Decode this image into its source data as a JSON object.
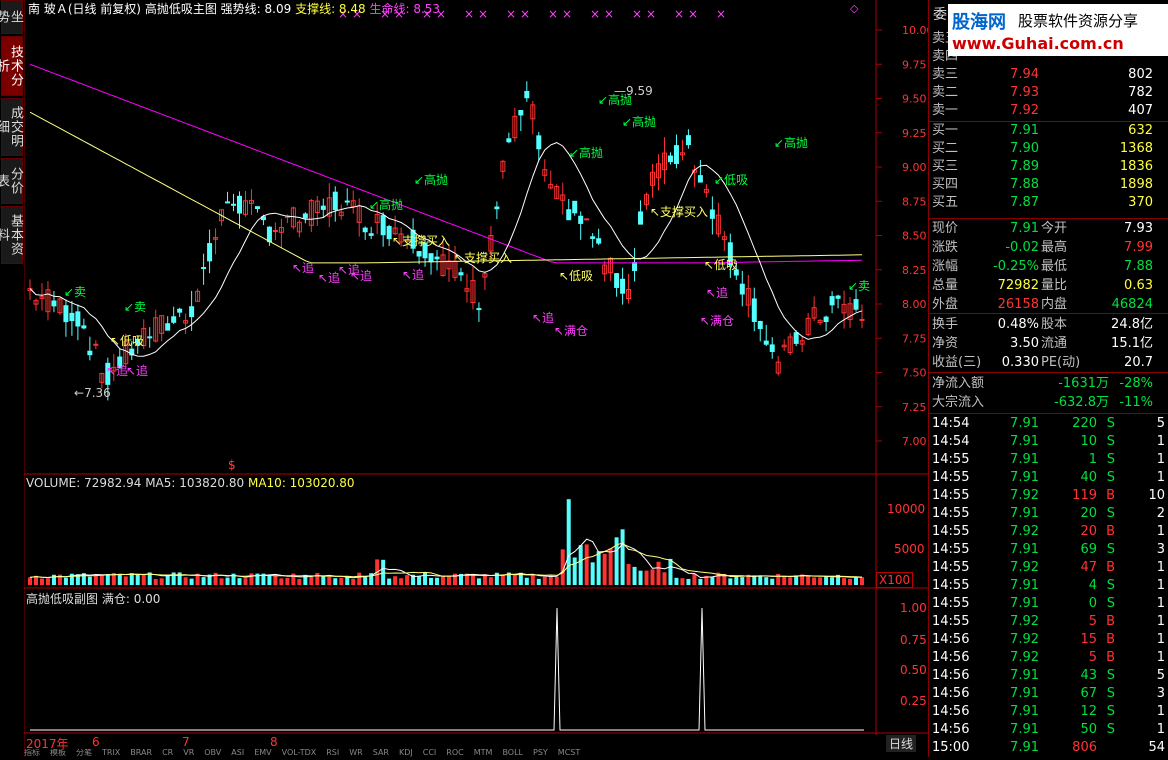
{
  "title_bar": {
    "stock": "南 玻Ａ(日线 前复权)",
    "indicator": "高抛低吸主图",
    "strong_label": "强势线: 8.09",
    "support_label": "支撑线: 8.48",
    "life_label": "生命线: 8.53"
  },
  "side_tabs": [
    "技术分析",
    "成交明细",
    "分价表",
    "基本资料"
  ],
  "side_top": "坐势",
  "price_axis": [
    "10.00",
    "9.75",
    "9.50",
    "9.25",
    "9.00",
    "8.75",
    "8.50",
    "8.25",
    "8.00",
    "7.75",
    "7.50",
    "7.25",
    "7.00"
  ],
  "annotations": {
    "high": "9.59",
    "low": "7.36",
    "sell_labels": [
      "卖",
      "卖",
      "卖"
    ],
    "high_throw": [
      "高抛",
      "高抛",
      "高抛",
      "高抛",
      "高抛",
      "高抛"
    ],
    "support_buy": [
      "支撑买入",
      "支撑买入",
      "支撑买入"
    ],
    "low_buy": [
      "低吸",
      "低吸",
      "低吸",
      "低吸"
    ],
    "chase": [
      "追",
      "追",
      "追",
      "追",
      "追",
      "追",
      "追",
      "追"
    ],
    "full": [
      "满仓",
      "满仓"
    ],
    "marker": "$"
  },
  "volume": {
    "label": "VOLUME: 72982.94",
    "ma5": "MA5: 103820.80",
    "ma10": "MA10: 103020.80",
    "axis": [
      "10000",
      "5000"
    ],
    "unit": "X100"
  },
  "sub": {
    "label": "高抛低吸副图",
    "value": "满仓: 0.00",
    "axis": [
      "1.00",
      "0.75",
      "0.50",
      "0.25"
    ]
  },
  "time_axis": [
    "2017年",
    "6",
    "7",
    "8"
  ],
  "period_btn": "日线",
  "bottom_tabs": [
    "指标",
    "模板",
    "分笔",
    "TRIX",
    "BRAR",
    "CR",
    "VR",
    "OBV",
    "ASI",
    "EMV",
    "VOL-TDX",
    "RSI",
    "WR",
    "SAR",
    "KDJ",
    "CCI",
    "ROC",
    "MTM",
    "BOLL",
    "PSY",
    "MCST"
  ],
  "watermark": {
    "site": "股海网",
    "slogan": "股票软件资源分享",
    "url": "www.Guhai.com.cn"
  },
  "quote": {
    "header_label": "委",
    "asks": [
      {
        "label": "卖五",
        "price": "",
        "vol": ""
      },
      {
        "label": "卖四",
        "price": "",
        "vol": ""
      },
      {
        "label": "卖三",
        "price": "7.94",
        "vol": "802"
      },
      {
        "label": "卖二",
        "price": "7.93",
        "vol": "782"
      },
      {
        "label": "卖一",
        "price": "7.92",
        "vol": "407"
      }
    ],
    "bids": [
      {
        "label": "买一",
        "price": "7.91",
        "vol": "632"
      },
      {
        "label": "买二",
        "price": "7.90",
        "vol": "1368"
      },
      {
        "label": "买三",
        "price": "7.89",
        "vol": "1836"
      },
      {
        "label": "买四",
        "price": "7.88",
        "vol": "1898"
      },
      {
        "label": "买五",
        "price": "7.87",
        "vol": "370"
      }
    ],
    "stats": [
      {
        "l1": "现价",
        "v1": "7.91",
        "c1": "green",
        "l2": "今开",
        "v2": "7.93",
        "c2": "white"
      },
      {
        "l1": "涨跌",
        "v1": "-0.02",
        "c1": "green",
        "l2": "最高",
        "v2": "7.99",
        "c2": "red"
      },
      {
        "l1": "涨幅",
        "v1": "-0.25%",
        "c1": "green",
        "l2": "最低",
        "v2": "7.88",
        "c2": "green"
      },
      {
        "l1": "总量",
        "v1": "72982",
        "c1": "yellow",
        "l2": "量比",
        "v2": "0.63",
        "c2": "yellow"
      },
      {
        "l1": "外盘",
        "v1": "26158",
        "c1": "red",
        "l2": "内盘",
        "v2": "46824",
        "c2": "green"
      }
    ],
    "fund": [
      {
        "l1": "换手",
        "v1": "0.48%",
        "l2": "股本",
        "v2": "24.8亿"
      },
      {
        "l1": "净资",
        "v1": "3.50",
        "l2": "流通",
        "v2": "15.1亿"
      },
      {
        "l1": "收益(三)",
        "v1": "0.330",
        "l2": "PE(动)",
        "v2": "20.7"
      }
    ],
    "flow": [
      {
        "l": "净流入额",
        "v": "-1631万",
        "p": "-28%"
      },
      {
        "l": "大宗流入",
        "v": "-632.8万",
        "p": "-11%"
      }
    ],
    "ticks": [
      {
        "t": "14:54",
        "p": "7.91",
        "v": "220",
        "s": "S",
        "n": "5"
      },
      {
        "t": "14:54",
        "p": "7.91",
        "v": "10",
        "s": "S",
        "n": "1"
      },
      {
        "t": "14:55",
        "p": "7.91",
        "v": "1",
        "s": "S",
        "n": "1"
      },
      {
        "t": "14:55",
        "p": "7.91",
        "v": "40",
        "s": "S",
        "n": "1"
      },
      {
        "t": "14:55",
        "p": "7.92",
        "v": "119",
        "s": "B",
        "n": "10"
      },
      {
        "t": "14:55",
        "p": "7.91",
        "v": "20",
        "s": "S",
        "n": "2"
      },
      {
        "t": "14:55",
        "p": "7.92",
        "v": "20",
        "s": "B",
        "n": "1"
      },
      {
        "t": "14:55",
        "p": "7.91",
        "v": "69",
        "s": "S",
        "n": "3"
      },
      {
        "t": "14:55",
        "p": "7.92",
        "v": "47",
        "s": "B",
        "n": "1"
      },
      {
        "t": "14:55",
        "p": "7.91",
        "v": "4",
        "s": "S",
        "n": "1"
      },
      {
        "t": "14:55",
        "p": "7.91",
        "v": "0",
        "s": "S",
        "n": "1"
      },
      {
        "t": "14:55",
        "p": "7.92",
        "v": "5",
        "s": "B",
        "n": "1"
      },
      {
        "t": "14:56",
        "p": "7.92",
        "v": "15",
        "s": "B",
        "n": "1"
      },
      {
        "t": "14:56",
        "p": "7.92",
        "v": "5",
        "s": "B",
        "n": "1"
      },
      {
        "t": "14:56",
        "p": "7.91",
        "v": "43",
        "s": "S",
        "n": "5"
      },
      {
        "t": "14:56",
        "p": "7.91",
        "v": "67",
        "s": "S",
        "n": "3"
      },
      {
        "t": "14:56",
        "p": "7.91",
        "v": "12",
        "s": "S",
        "n": "1"
      },
      {
        "t": "14:56",
        "p": "7.91",
        "v": "50",
        "s": "S",
        "n": "1"
      },
      {
        "t": "15:00",
        "p": "7.91",
        "v": "806",
        "s": "",
        "n": "54"
      }
    ]
  },
  "colors": {
    "up": "#ff3232",
    "down": "#54ffff",
    "ma_pink": "#ff00ff",
    "ma_yellow": "#ffff80",
    "axis": "#b00000",
    "text_green": "#00e040"
  }
}
